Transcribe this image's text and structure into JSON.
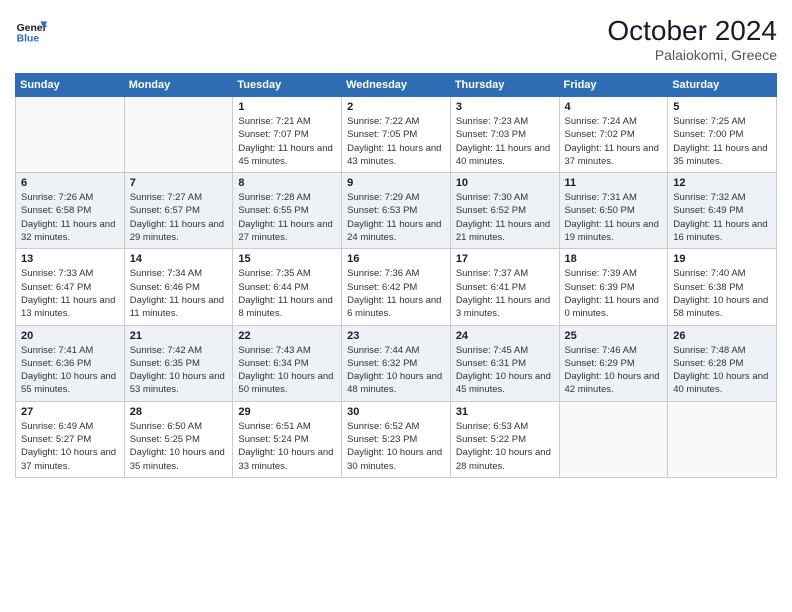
{
  "header": {
    "logo_general": "General",
    "logo_blue": "Blue",
    "month_title": "October 2024",
    "location": "Palaiokomi, Greece"
  },
  "weekdays": [
    "Sunday",
    "Monday",
    "Tuesday",
    "Wednesday",
    "Thursday",
    "Friday",
    "Saturday"
  ],
  "weeks": [
    [
      {
        "day": "",
        "sunrise": "",
        "sunset": "",
        "daylight": ""
      },
      {
        "day": "",
        "sunrise": "",
        "sunset": "",
        "daylight": ""
      },
      {
        "day": "1",
        "sunrise": "Sunrise: 7:21 AM",
        "sunset": "Sunset: 7:07 PM",
        "daylight": "Daylight: 11 hours and 45 minutes."
      },
      {
        "day": "2",
        "sunrise": "Sunrise: 7:22 AM",
        "sunset": "Sunset: 7:05 PM",
        "daylight": "Daylight: 11 hours and 43 minutes."
      },
      {
        "day": "3",
        "sunrise": "Sunrise: 7:23 AM",
        "sunset": "Sunset: 7:03 PM",
        "daylight": "Daylight: 11 hours and 40 minutes."
      },
      {
        "day": "4",
        "sunrise": "Sunrise: 7:24 AM",
        "sunset": "Sunset: 7:02 PM",
        "daylight": "Daylight: 11 hours and 37 minutes."
      },
      {
        "day": "5",
        "sunrise": "Sunrise: 7:25 AM",
        "sunset": "Sunset: 7:00 PM",
        "daylight": "Daylight: 11 hours and 35 minutes."
      }
    ],
    [
      {
        "day": "6",
        "sunrise": "Sunrise: 7:26 AM",
        "sunset": "Sunset: 6:58 PM",
        "daylight": "Daylight: 11 hours and 32 minutes."
      },
      {
        "day": "7",
        "sunrise": "Sunrise: 7:27 AM",
        "sunset": "Sunset: 6:57 PM",
        "daylight": "Daylight: 11 hours and 29 minutes."
      },
      {
        "day": "8",
        "sunrise": "Sunrise: 7:28 AM",
        "sunset": "Sunset: 6:55 PM",
        "daylight": "Daylight: 11 hours and 27 minutes."
      },
      {
        "day": "9",
        "sunrise": "Sunrise: 7:29 AM",
        "sunset": "Sunset: 6:53 PM",
        "daylight": "Daylight: 11 hours and 24 minutes."
      },
      {
        "day": "10",
        "sunrise": "Sunrise: 7:30 AM",
        "sunset": "Sunset: 6:52 PM",
        "daylight": "Daylight: 11 hours and 21 minutes."
      },
      {
        "day": "11",
        "sunrise": "Sunrise: 7:31 AM",
        "sunset": "Sunset: 6:50 PM",
        "daylight": "Daylight: 11 hours and 19 minutes."
      },
      {
        "day": "12",
        "sunrise": "Sunrise: 7:32 AM",
        "sunset": "Sunset: 6:49 PM",
        "daylight": "Daylight: 11 hours and 16 minutes."
      }
    ],
    [
      {
        "day": "13",
        "sunrise": "Sunrise: 7:33 AM",
        "sunset": "Sunset: 6:47 PM",
        "daylight": "Daylight: 11 hours and 13 minutes."
      },
      {
        "day": "14",
        "sunrise": "Sunrise: 7:34 AM",
        "sunset": "Sunset: 6:46 PM",
        "daylight": "Daylight: 11 hours and 11 minutes."
      },
      {
        "day": "15",
        "sunrise": "Sunrise: 7:35 AM",
        "sunset": "Sunset: 6:44 PM",
        "daylight": "Daylight: 11 hours and 8 minutes."
      },
      {
        "day": "16",
        "sunrise": "Sunrise: 7:36 AM",
        "sunset": "Sunset: 6:42 PM",
        "daylight": "Daylight: 11 hours and 6 minutes."
      },
      {
        "day": "17",
        "sunrise": "Sunrise: 7:37 AM",
        "sunset": "Sunset: 6:41 PM",
        "daylight": "Daylight: 11 hours and 3 minutes."
      },
      {
        "day": "18",
        "sunrise": "Sunrise: 7:39 AM",
        "sunset": "Sunset: 6:39 PM",
        "daylight": "Daylight: 11 hours and 0 minutes."
      },
      {
        "day": "19",
        "sunrise": "Sunrise: 7:40 AM",
        "sunset": "Sunset: 6:38 PM",
        "daylight": "Daylight: 10 hours and 58 minutes."
      }
    ],
    [
      {
        "day": "20",
        "sunrise": "Sunrise: 7:41 AM",
        "sunset": "Sunset: 6:36 PM",
        "daylight": "Daylight: 10 hours and 55 minutes."
      },
      {
        "day": "21",
        "sunrise": "Sunrise: 7:42 AM",
        "sunset": "Sunset: 6:35 PM",
        "daylight": "Daylight: 10 hours and 53 minutes."
      },
      {
        "day": "22",
        "sunrise": "Sunrise: 7:43 AM",
        "sunset": "Sunset: 6:34 PM",
        "daylight": "Daylight: 10 hours and 50 minutes."
      },
      {
        "day": "23",
        "sunrise": "Sunrise: 7:44 AM",
        "sunset": "Sunset: 6:32 PM",
        "daylight": "Daylight: 10 hours and 48 minutes."
      },
      {
        "day": "24",
        "sunrise": "Sunrise: 7:45 AM",
        "sunset": "Sunset: 6:31 PM",
        "daylight": "Daylight: 10 hours and 45 minutes."
      },
      {
        "day": "25",
        "sunrise": "Sunrise: 7:46 AM",
        "sunset": "Sunset: 6:29 PM",
        "daylight": "Daylight: 10 hours and 42 minutes."
      },
      {
        "day": "26",
        "sunrise": "Sunrise: 7:48 AM",
        "sunset": "Sunset: 6:28 PM",
        "daylight": "Daylight: 10 hours and 40 minutes."
      }
    ],
    [
      {
        "day": "27",
        "sunrise": "Sunrise: 6:49 AM",
        "sunset": "Sunset: 5:27 PM",
        "daylight": "Daylight: 10 hours and 37 minutes."
      },
      {
        "day": "28",
        "sunrise": "Sunrise: 6:50 AM",
        "sunset": "Sunset: 5:25 PM",
        "daylight": "Daylight: 10 hours and 35 minutes."
      },
      {
        "day": "29",
        "sunrise": "Sunrise: 6:51 AM",
        "sunset": "Sunset: 5:24 PM",
        "daylight": "Daylight: 10 hours and 33 minutes."
      },
      {
        "day": "30",
        "sunrise": "Sunrise: 6:52 AM",
        "sunset": "Sunset: 5:23 PM",
        "daylight": "Daylight: 10 hours and 30 minutes."
      },
      {
        "day": "31",
        "sunrise": "Sunrise: 6:53 AM",
        "sunset": "Sunset: 5:22 PM",
        "daylight": "Daylight: 10 hours and 28 minutes."
      },
      {
        "day": "",
        "sunrise": "",
        "sunset": "",
        "daylight": ""
      },
      {
        "day": "",
        "sunrise": "",
        "sunset": "",
        "daylight": ""
      }
    ]
  ]
}
